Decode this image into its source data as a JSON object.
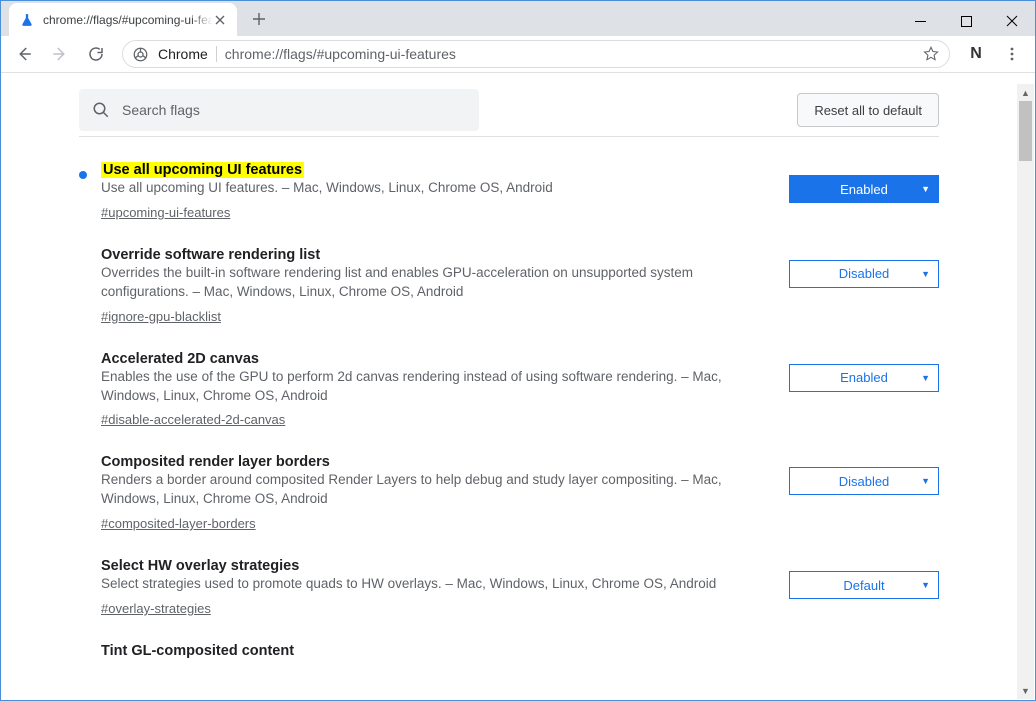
{
  "tab": {
    "title": "chrome://flags/#upcoming-ui-features"
  },
  "omnibox": {
    "scheme_label": "Chrome",
    "url_rest": "chrome://flags/#upcoming-ui-features"
  },
  "toolbar_right": {
    "extension_letter": "N"
  },
  "search": {
    "placeholder": "Search flags"
  },
  "reset_label": "Reset all to default",
  "flags": [
    {
      "title": "Use all upcoming UI features",
      "description": "Use all upcoming UI features. – Mac, Windows, Linux, Chrome OS, Android",
      "anchor": "#upcoming-ui-features",
      "value": "Enabled",
      "highlighted": true,
      "modified": true
    },
    {
      "title": "Override software rendering list",
      "description": "Overrides the built-in software rendering list and enables GPU-acceleration on unsupported system configurations. – Mac, Windows, Linux, Chrome OS, Android",
      "anchor": "#ignore-gpu-blacklist",
      "value": "Disabled",
      "highlighted": false,
      "modified": false
    },
    {
      "title": "Accelerated 2D canvas",
      "description": "Enables the use of the GPU to perform 2d canvas rendering instead of using software rendering. – Mac, Windows, Linux, Chrome OS, Android",
      "anchor": "#disable-accelerated-2d-canvas",
      "value": "Enabled",
      "highlighted": false,
      "modified": false
    },
    {
      "title": "Composited render layer borders",
      "description": "Renders a border around composited Render Layers to help debug and study layer compositing. – Mac, Windows, Linux, Chrome OS, Android",
      "anchor": "#composited-layer-borders",
      "value": "Disabled",
      "highlighted": false,
      "modified": false
    },
    {
      "title": "Select HW overlay strategies",
      "description": "Select strategies used to promote quads to HW overlays. – Mac, Windows, Linux, Chrome OS, Android",
      "anchor": "#overlay-strategies",
      "value": "Default",
      "highlighted": false,
      "modified": false
    },
    {
      "title": "Tint GL-composited content",
      "description": "",
      "anchor": "",
      "value": "",
      "highlighted": false,
      "modified": false
    }
  ]
}
